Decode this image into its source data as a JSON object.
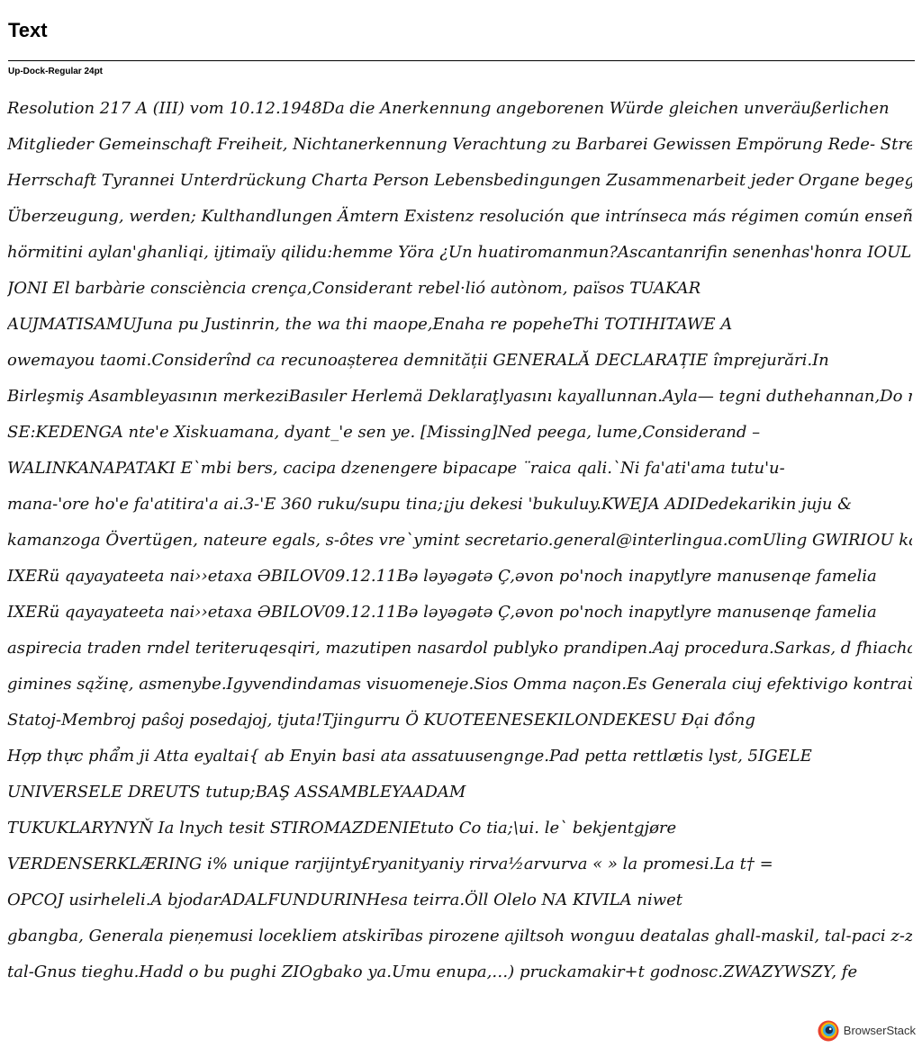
{
  "header": {
    "title": "Text"
  },
  "font_label": "Up-Dock-Regular 24pt",
  "sample_lines": [
    "Resolution 217 A (III) vom 10.12.1948Da die Anerkennung angeborenen Würde gleichen unveräußerlichen",
    "Mitglieder Gemeinschaft Freiheit, Nichtanerkennung Verachtung zu Barbarei Gewissen Empörung Rede- Streben",
    "Herrschaft Tyrannei Unterdrückung Charta Person Lebensbedingungen Zusammenarbeit jeder Organe begegnen Jeder",
    "Überzeugung, werden; Kulthandlungen Ämtern Existenz resolución que intrínseca más régimen común enseñanza izzet-",
    "hörmitini aylan'ghanliqi, ijtimaïy qilidu:hemme Yöra ¿Un huatiromanmun?Ascantanrifin senenhas'honra IOUL",
    "JONI El barbàrie consciència crença,Considerant rebel·lió autònom, països TUAKAR",
    "AUJMATISAMUJuna pu Justinrin, the wa thi maope,Enaha re popeheThi TOTIHITAWE A",
    "owemayou taomi.Considerînd ca recunoașterea demnității GENERALĂ DECLARAȚIE împrejurări.In",
    "Birleşmiş Asambleyasının merkeziBasıler Herlemä Deklaraţlyasını kayallunnan.Ayla— tegni duthehannan,Do nga",
    "SE:KEDENGA nte'e Xiskuamana, dyant_'e sen ye. [Missing]Ned peega, lume,Considerand –",
    "WALINKANAPATAKI E`mbi bers, cacipa dzenengere bipacape ¨raica qali.`Ni fa'ati'ama tutu'u-",
    "mana-'ore ho'e fa'atitira'a ai.3-'E 360 ruku/supu tina;¡ju dekesi 'bukuluy.KWEJA ADIDedekarikin juju &",
    "kamanzoga Övertügen, nateure egals, s-ôtes vre`ymint secretario.general@interlingua.comUling GWIRIOU ka nüxü",
    "IXERü qayayateeta nai››etaxa ƏBILOV09.12.11Bə ləyəgətə Ç,əvon po'noch inapytlyre manusenqe famelia",
    "IXERü qayayateeta nai››etaxa ƏBILOV09.12.11Bə ləyəgətə Ç,əvon po'noch inapytlyre manusenqe famelia",
    "aspirecia traden rndel teriteruqesqiri, mazutipen nasardol publyko prandipen.Aaj procedura.Sarkas, d fhiacha i zmoniu",
    "gimines sąžinę, asmenybe.Igyvendindamas visuomeneje.Sios Omma naçon.Es Generala ciuj efektivigo kontraŭ Carto",
    "Statoj-Membroj paŝoj posedajoj, tjuta!Tjingurru Ö KUOTEENESEKILONDEKESU Đại đồng",
    "Hợp thực phẩm ji Atta eyaltai{ ab Enyin basi ata assatuusengnge.Pad petta rettlætis lyst, 5IGELE",
    "UNIVERSELE DREUTS tutup;BAŞ ASSAMBLEYAADAM",
    "TUKUKLARYNYŇ Ia lnych tesit STIROMAZDENIEtuto Co tia;\\ui. le` bekjentgjøre",
    "VERDENSERKLÆRING i% unique rarjijnty£ryanityaniy rirva½arvurva « » la promesi.La t† =",
    "OPCOJ usirheleli.A bjodarADALFUNDURINHesa teirra.Öll Olelo NA KIVILA niwet",
    "gbangba, Generala pieņemusi locekliem atskirības pirozene ajiltsoh wonguu deatalas ghall-maskil, tal-paci z-zeblik gabu",
    "tal-Gnus tieghu.Hadd o bu pughi ZIOgbako ya.Umu enupa,…) pruckamakir+t godnosc.ZWAZYWSZY, fe"
  ],
  "brand": {
    "name": "BrowserStack",
    "icon": "browserstack-logo-icon",
    "colors": [
      "#e8412c",
      "#f7b500",
      "#35a9e0",
      "#1b2a4a"
    ]
  }
}
